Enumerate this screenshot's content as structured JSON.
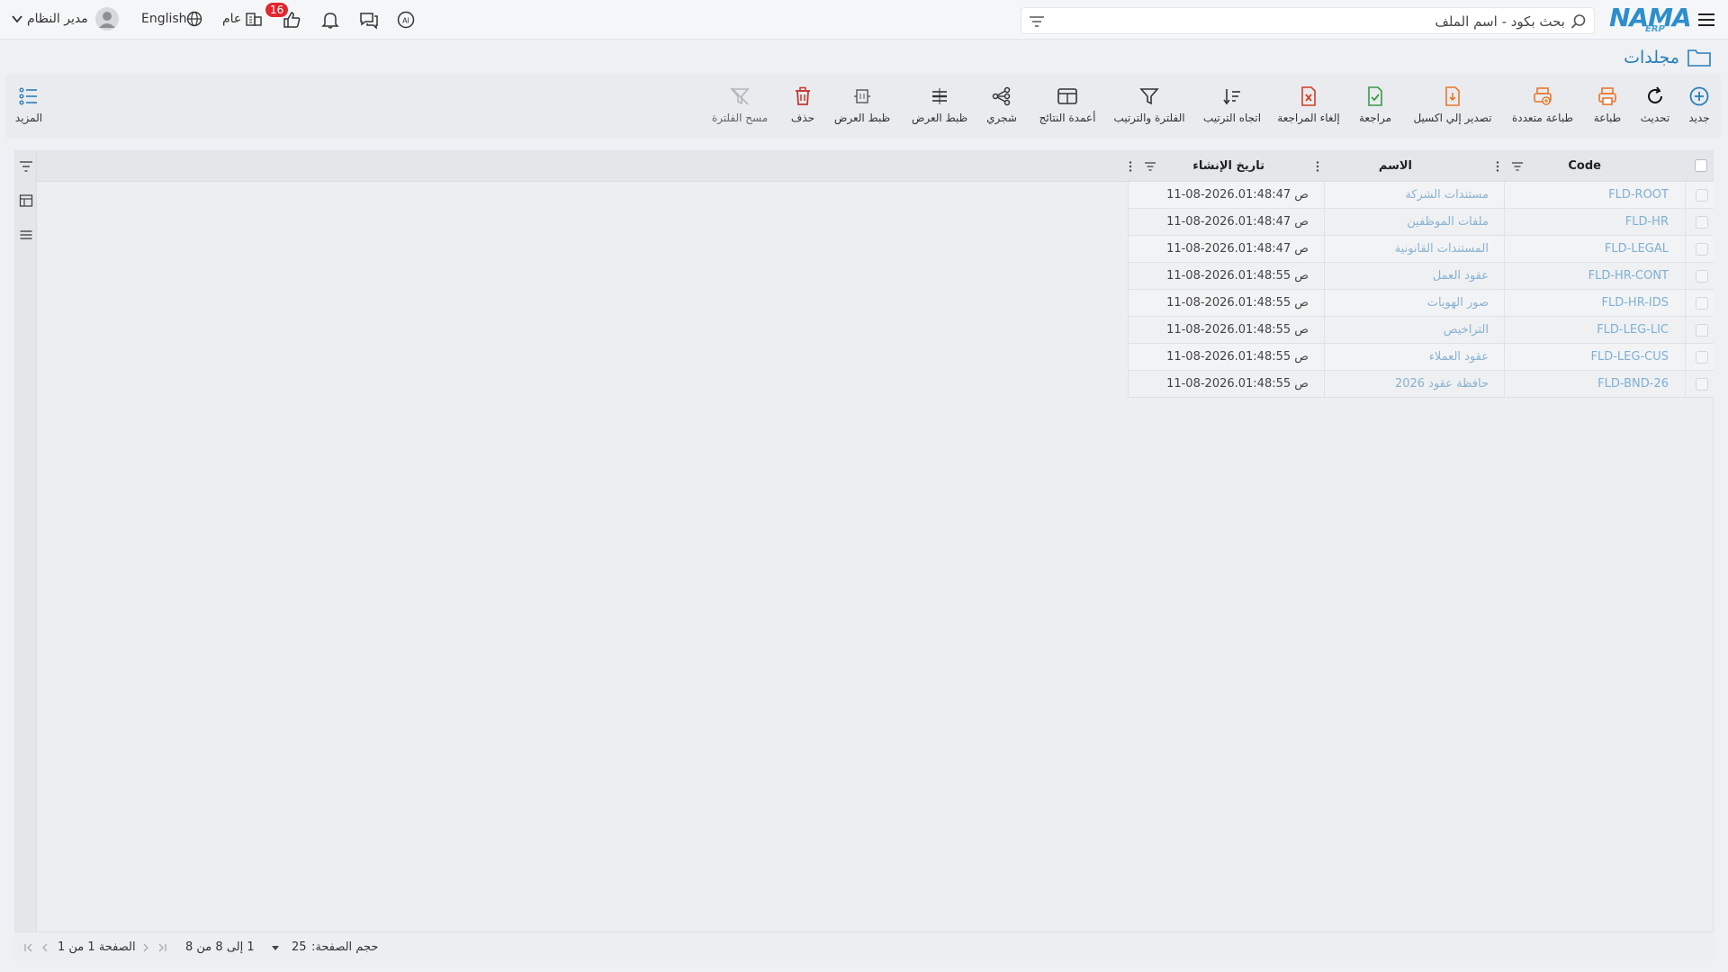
{
  "header": {
    "logo_text": "NAMA",
    "logo_sub": "ERP",
    "search_placeholder": "بحث بكود - اسم الملف",
    "user_name": "مدير النظام",
    "language": "English",
    "branch": "عام",
    "notification_count": "16"
  },
  "page": {
    "title": "مجلدات"
  },
  "toolbar": {
    "new": "جديد",
    "refresh": "تحديث",
    "print": "طباعة",
    "multi_print": "طباعة متعددة",
    "export_excel": "تصدير إلي اكسيل",
    "review": "مراجعة",
    "cancel_review": "إلغاء المراجعة",
    "sort_direction": "اتجاه الترتيب",
    "filter_sort": "الفلترة والترتيب",
    "result_columns": "أعمدة النتائج",
    "tree": "شجري",
    "view_adjust_1": "ظبط العرض",
    "view_adjust_2": "ظبط العرض",
    "delete": "حذف",
    "clear_filter": "مسح الفلترة",
    "more": "المزيد"
  },
  "grid": {
    "columns": {
      "code": "Code",
      "name": "الاسم",
      "created": "تاريخ الإنشاء"
    },
    "rows": [
      {
        "code": "FLD-ROOT",
        "name": "مستندات الشركة",
        "created": "11-08-2026.01:48:47 ص"
      },
      {
        "code": "FLD-HR",
        "name": "ملفات الموظفين",
        "created": "11-08-2026.01:48:47 ص"
      },
      {
        "code": "FLD-LEGAL",
        "name": "المستندات القانونية",
        "created": "11-08-2026.01:48:47 ص"
      },
      {
        "code": "FLD-HR-CONT",
        "name": "عقود العمل",
        "created": "11-08-2026.01:48:55 ص"
      },
      {
        "code": "FLD-HR-IDS",
        "name": "صور الهويات",
        "created": "11-08-2026.01:48:55 ص"
      },
      {
        "code": "FLD-LEG-LIC",
        "name": "التراخيص",
        "created": "11-08-2026.01:48:55 ص"
      },
      {
        "code": "FLD-LEG-CUS",
        "name": "عقود العملاء",
        "created": "11-08-2026.01:48:55 ص"
      },
      {
        "code": "FLD-BND-26",
        "name": "حافظة عقود 2026",
        "created": "11-08-2026.01:48:55 ص"
      }
    ]
  },
  "pagination": {
    "page_size_label": "حجم الصفحة:",
    "page_size": "25",
    "range_text": "1 إلى 8 من 8",
    "page_text": "الصفحة 1 من 1"
  },
  "colors": {
    "accent": "#2a7fb8",
    "orange": "#e8772e",
    "red": "#d0402b",
    "green": "#3a9a4a",
    "link": "#7fb0d3"
  }
}
